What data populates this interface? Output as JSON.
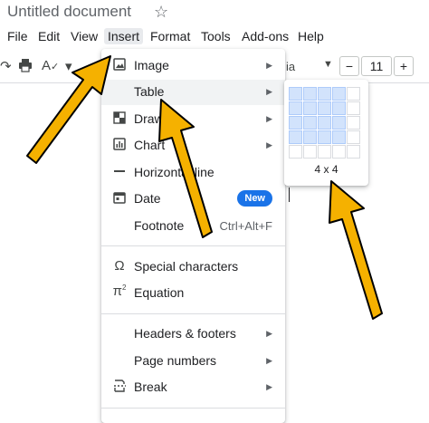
{
  "header": {
    "doc_title": "Untitled document",
    "star_icon": "☆"
  },
  "menu_bar": {
    "items": [
      "File",
      "Edit",
      "View",
      "Insert",
      "Format",
      "Tools",
      "Add-ons",
      "Help"
    ],
    "active": "Insert"
  },
  "toolbar": {
    "font_partial": "ia",
    "font_size": "11",
    "minus": "−",
    "plus": "+"
  },
  "insert_menu": {
    "items": [
      {
        "label": "Image",
        "icon": "image-icon",
        "submenu": true
      },
      {
        "label": "Table",
        "icon": "",
        "submenu": true,
        "highlighted": true
      },
      {
        "label": "Drawing",
        "icon": "drawing-icon",
        "submenu": true
      },
      {
        "label": "Chart",
        "icon": "chart-icon",
        "submenu": true
      },
      {
        "label": "Horizontal line",
        "icon": "horizontal-line-icon",
        "submenu": false
      },
      {
        "label": "Date",
        "icon": "calendar-icon",
        "badge": "New"
      },
      {
        "label": "Footnote",
        "icon": "",
        "shortcut": "Ctrl+Alt+F"
      },
      {
        "label": "Special characters",
        "icon": "omega-icon",
        "submenu": false
      },
      {
        "label": "Equation",
        "icon": "pi-icon",
        "submenu": false
      },
      {
        "label": "Headers & footers",
        "icon": "",
        "submenu": true
      },
      {
        "label": "Page numbers",
        "icon": "",
        "submenu": true
      },
      {
        "label": "Break",
        "icon": "break-icon",
        "submenu": true
      }
    ]
  },
  "table_picker": {
    "size_label": "4 x 4",
    "selected_rows": 4,
    "selected_cols": 4,
    "grid_rows": 5,
    "grid_cols": 5
  },
  "annotation_colors": {
    "arrow_fill": "#f5b100",
    "arrow_stroke": "#000000"
  }
}
